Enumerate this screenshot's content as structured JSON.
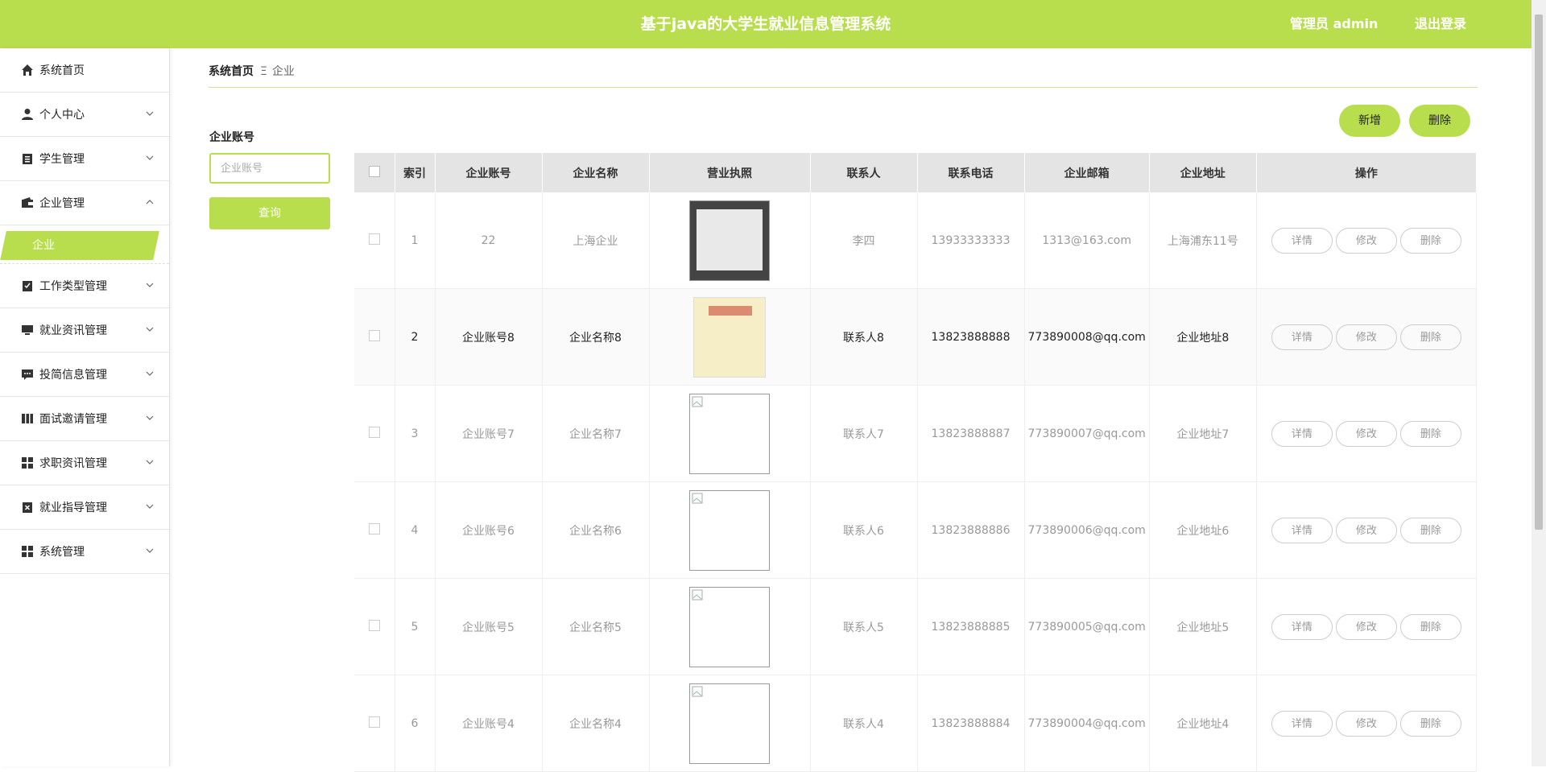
{
  "header": {
    "title": "基于java的大学生就业信息管理系统",
    "user": "管理员 admin",
    "logout": "退出登录"
  },
  "sidebar": {
    "items": [
      {
        "label": "系统首页",
        "icon": "home-icon"
      },
      {
        "label": "个人中心",
        "icon": "user-icon"
      },
      {
        "label": "学生管理",
        "icon": "clipboard-icon"
      },
      {
        "label": "企业管理",
        "icon": "wallet-icon"
      },
      {
        "label": "工作类型管理",
        "icon": "checklist-icon"
      },
      {
        "label": "就业资讯管理",
        "icon": "monitor-icon"
      },
      {
        "label": "投简信息管理",
        "icon": "chat-icon"
      },
      {
        "label": "面试邀请管理",
        "icon": "book-icon"
      },
      {
        "label": "求职资讯管理",
        "icon": "grid-icon"
      },
      {
        "label": "就业指导管理",
        "icon": "clipboard-x-icon"
      },
      {
        "label": "系统管理",
        "icon": "grid-icon"
      }
    ],
    "active_sub": "企业"
  },
  "breadcrumb": {
    "home": "系统首页",
    "sep": "Ξ",
    "current": "企业"
  },
  "search": {
    "label": "企业账号",
    "placeholder": "企业账号",
    "button": "查询"
  },
  "actions": {
    "add": "新增",
    "delete": "删除"
  },
  "table": {
    "headers": [
      "索引",
      "企业账号",
      "企业名称",
      "营业执照",
      "联系人",
      "联系电话",
      "企业邮箱",
      "企业地址",
      "操作"
    ],
    "rows": [
      {
        "index": "1",
        "account": "22",
        "name": "上海企业",
        "image": "photo",
        "contact": "李四",
        "phone": "13933333333",
        "email": "1313@163.com",
        "address": "上海浦东11号"
      },
      {
        "index": "2",
        "account": "企业账号8",
        "name": "企业名称8",
        "image": "certificate",
        "contact": "联系人8",
        "phone": "13823888888",
        "email": "773890008@qq.com",
        "address": "企业地址8"
      },
      {
        "index": "3",
        "account": "企业账号7",
        "name": "企业名称7",
        "image": "broken",
        "contact": "联系人7",
        "phone": "13823888887",
        "email": "773890007@qq.com",
        "address": "企业地址7"
      },
      {
        "index": "4",
        "account": "企业账号6",
        "name": "企业名称6",
        "image": "broken",
        "contact": "联系人6",
        "phone": "13823888886",
        "email": "773890006@qq.com",
        "address": "企业地址6"
      },
      {
        "index": "5",
        "account": "企业账号5",
        "name": "企业名称5",
        "image": "broken",
        "contact": "联系人5",
        "phone": "13823888885",
        "email": "773890005@qq.com",
        "address": "企业地址5"
      },
      {
        "index": "6",
        "account": "企业账号4",
        "name": "企业名称4",
        "image": "broken",
        "contact": "联系人4",
        "phone": "13823888884",
        "email": "773890004@qq.com",
        "address": "企业地址4"
      }
    ],
    "row_buttons": [
      "详情",
      "修改",
      "删除"
    ]
  },
  "colors": {
    "accent": "#b8de4d"
  }
}
